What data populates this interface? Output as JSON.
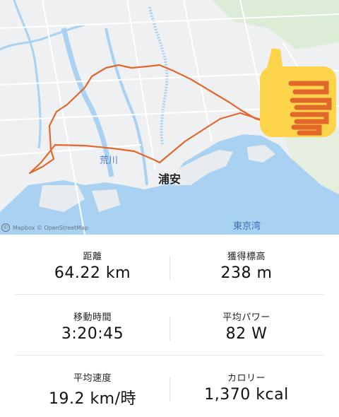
{
  "map": {
    "labels": {
      "river": "荒川",
      "city": "浦安",
      "bay": "東京湾"
    },
    "attribution": {
      "logo_text": "©",
      "text": "Mapbox © OpenStreetMap"
    },
    "route_color": "#e2672b",
    "water_color": "#a9d1f2",
    "thumbs_up_emoji": "thumbs-up-icon"
  },
  "stats": {
    "distance": {
      "label": "距離",
      "value": "64.22 km"
    },
    "elevation_gain": {
      "label": "獲得標高",
      "value": "238 m"
    },
    "moving_time": {
      "label": "移動時間",
      "value": "3:20:45"
    },
    "avg_power": {
      "label": "平均パワー",
      "value": "82 W"
    },
    "avg_speed": {
      "label": "平均速度",
      "value": "19.2 km/時"
    },
    "calories": {
      "label": "カロリー",
      "value": "1,370 kcal"
    }
  }
}
